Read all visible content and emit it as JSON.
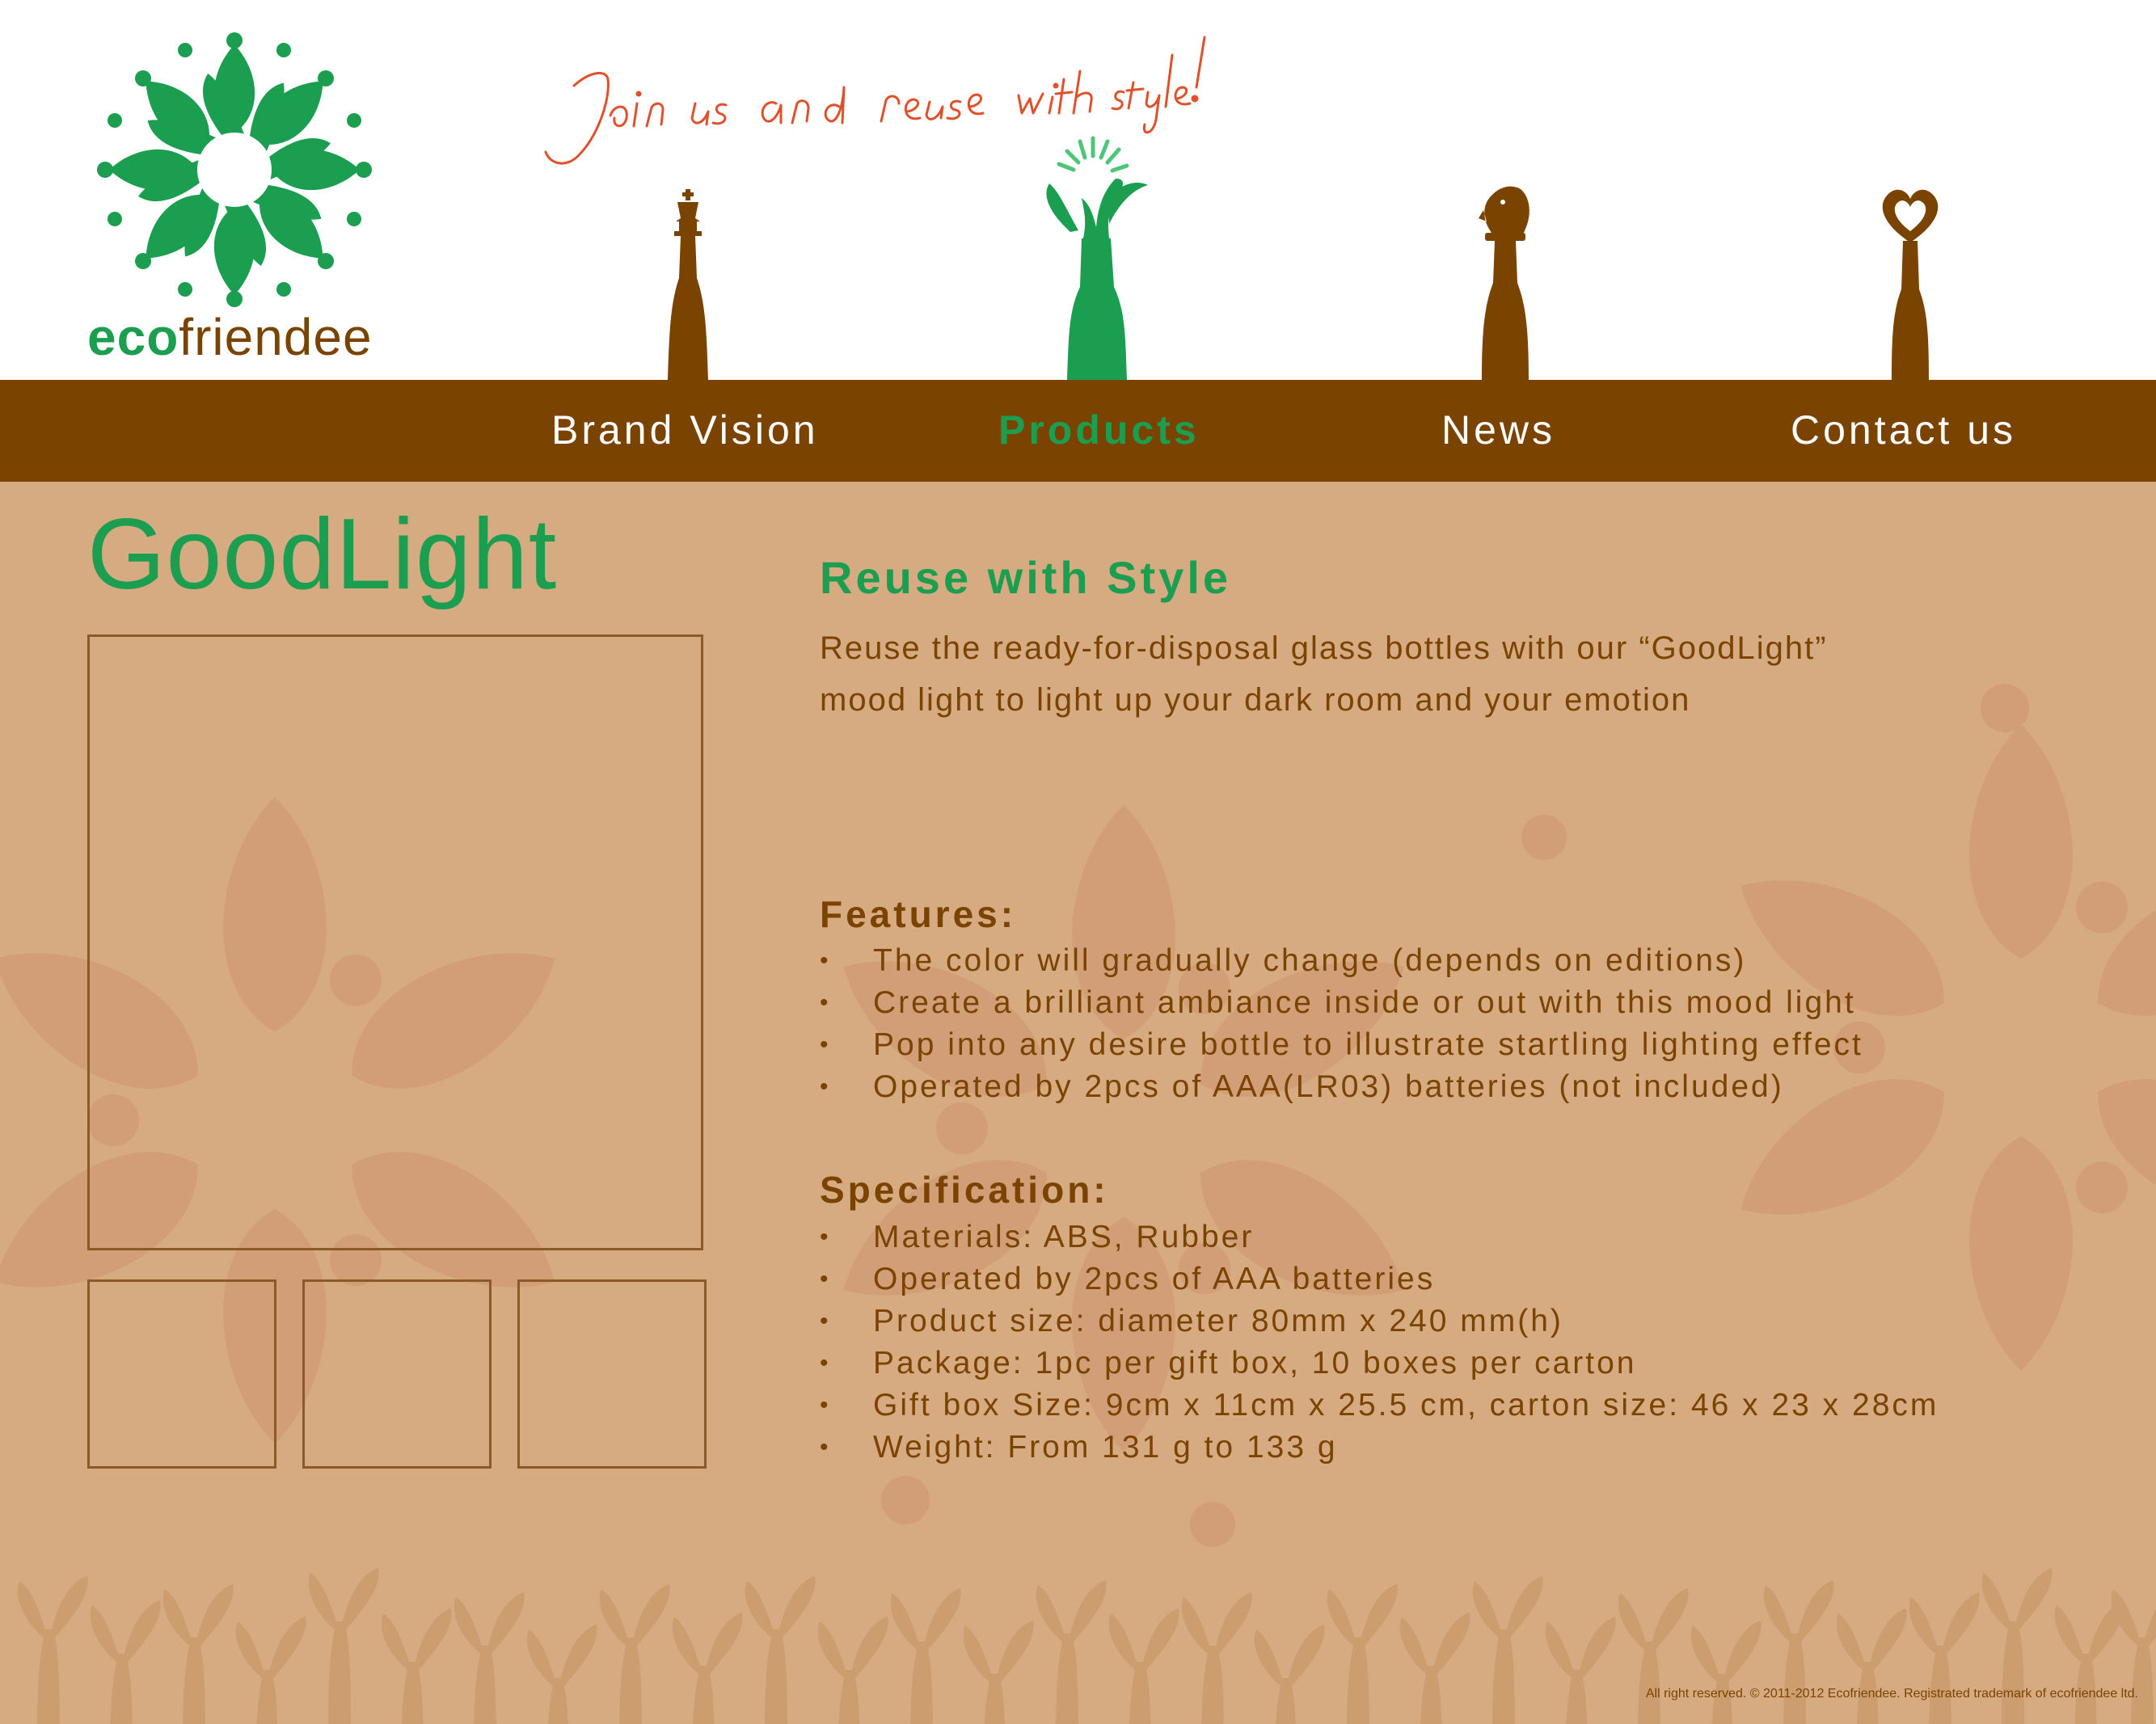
{
  "brand": {
    "eco": "eco",
    "friendee": "friendee",
    "slogan": "Join us and reuse with style!"
  },
  "nav": [
    {
      "label": "Brand Vision",
      "active": false
    },
    {
      "label": "Products",
      "active": true
    },
    {
      "label": "News",
      "active": false
    },
    {
      "label": "Contact us",
      "active": false
    }
  ],
  "product": {
    "title": "GoodLight",
    "tagline": "Reuse with Style",
    "intro": "Reuse the ready-for-disposal glass bottles with our “GoodLight” mood light to light up your dark room and your emotion"
  },
  "features": {
    "heading": "Features:",
    "items": [
      "The color will gradually change (depends on editions)",
      "Create a brilliant ambiance inside or out with this mood light",
      "Pop into any desire bottle to illustrate startling lighting effect",
      "Operated by 2pcs of AAA(LR03) batteries (not included)"
    ]
  },
  "specification": {
    "heading": "Specification:",
    "items": [
      "Materials: ABS, Rubber",
      "Operated by 2pcs of AAA batteries",
      "Product size: diameter 80mm x 240 mm(h)",
      "Package: 1pc per gift box, 10 boxes per carton",
      "Gift box Size: 9cm x 11cm x 25.5 cm, carton size: 46 x 23 x 28cm",
      "Weight: From 131 g to 133 g"
    ]
  },
  "footer": {
    "copyright": "All right reserved. © 2011-2012 Ecofriendee. Registrated trademark of ecofriendee ltd."
  },
  "colors": {
    "green": "#1b9e4f",
    "brown": "#7b4300",
    "tan": "#d6ab82",
    "accent_orange": "#e0502a"
  },
  "icons": [
    "logo-flower-icon",
    "king-bottle-icon",
    "sprout-bottle-icon",
    "knight-bottle-icon",
    "heart-bottle-icon"
  ]
}
